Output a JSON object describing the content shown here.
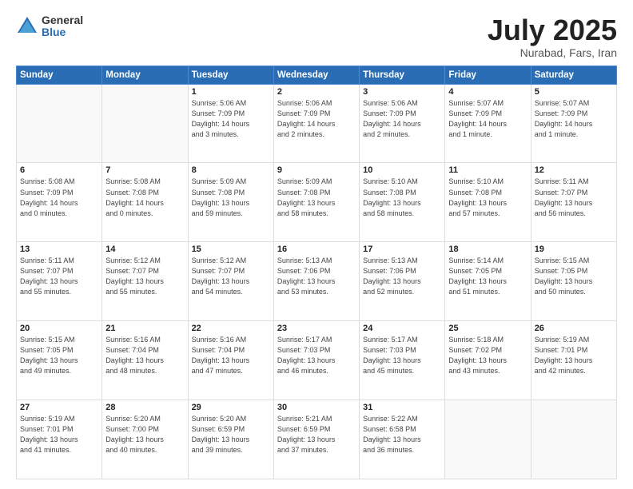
{
  "logo": {
    "general": "General",
    "blue": "Blue"
  },
  "title": "July 2025",
  "location": "Nurabad, Fars, Iran",
  "days_of_week": [
    "Sunday",
    "Monday",
    "Tuesday",
    "Wednesday",
    "Thursday",
    "Friday",
    "Saturday"
  ],
  "weeks": [
    [
      {
        "day": "",
        "detail": ""
      },
      {
        "day": "",
        "detail": ""
      },
      {
        "day": "1",
        "detail": "Sunrise: 5:06 AM\nSunset: 7:09 PM\nDaylight: 14 hours\nand 3 minutes."
      },
      {
        "day": "2",
        "detail": "Sunrise: 5:06 AM\nSunset: 7:09 PM\nDaylight: 14 hours\nand 2 minutes."
      },
      {
        "day": "3",
        "detail": "Sunrise: 5:06 AM\nSunset: 7:09 PM\nDaylight: 14 hours\nand 2 minutes."
      },
      {
        "day": "4",
        "detail": "Sunrise: 5:07 AM\nSunset: 7:09 PM\nDaylight: 14 hours\nand 1 minute."
      },
      {
        "day": "5",
        "detail": "Sunrise: 5:07 AM\nSunset: 7:09 PM\nDaylight: 14 hours\nand 1 minute."
      }
    ],
    [
      {
        "day": "6",
        "detail": "Sunrise: 5:08 AM\nSunset: 7:09 PM\nDaylight: 14 hours\nand 0 minutes."
      },
      {
        "day": "7",
        "detail": "Sunrise: 5:08 AM\nSunset: 7:08 PM\nDaylight: 14 hours\nand 0 minutes."
      },
      {
        "day": "8",
        "detail": "Sunrise: 5:09 AM\nSunset: 7:08 PM\nDaylight: 13 hours\nand 59 minutes."
      },
      {
        "day": "9",
        "detail": "Sunrise: 5:09 AM\nSunset: 7:08 PM\nDaylight: 13 hours\nand 58 minutes."
      },
      {
        "day": "10",
        "detail": "Sunrise: 5:10 AM\nSunset: 7:08 PM\nDaylight: 13 hours\nand 58 minutes."
      },
      {
        "day": "11",
        "detail": "Sunrise: 5:10 AM\nSunset: 7:08 PM\nDaylight: 13 hours\nand 57 minutes."
      },
      {
        "day": "12",
        "detail": "Sunrise: 5:11 AM\nSunset: 7:07 PM\nDaylight: 13 hours\nand 56 minutes."
      }
    ],
    [
      {
        "day": "13",
        "detail": "Sunrise: 5:11 AM\nSunset: 7:07 PM\nDaylight: 13 hours\nand 55 minutes."
      },
      {
        "day": "14",
        "detail": "Sunrise: 5:12 AM\nSunset: 7:07 PM\nDaylight: 13 hours\nand 55 minutes."
      },
      {
        "day": "15",
        "detail": "Sunrise: 5:12 AM\nSunset: 7:07 PM\nDaylight: 13 hours\nand 54 minutes."
      },
      {
        "day": "16",
        "detail": "Sunrise: 5:13 AM\nSunset: 7:06 PM\nDaylight: 13 hours\nand 53 minutes."
      },
      {
        "day": "17",
        "detail": "Sunrise: 5:13 AM\nSunset: 7:06 PM\nDaylight: 13 hours\nand 52 minutes."
      },
      {
        "day": "18",
        "detail": "Sunrise: 5:14 AM\nSunset: 7:05 PM\nDaylight: 13 hours\nand 51 minutes."
      },
      {
        "day": "19",
        "detail": "Sunrise: 5:15 AM\nSunset: 7:05 PM\nDaylight: 13 hours\nand 50 minutes."
      }
    ],
    [
      {
        "day": "20",
        "detail": "Sunrise: 5:15 AM\nSunset: 7:05 PM\nDaylight: 13 hours\nand 49 minutes."
      },
      {
        "day": "21",
        "detail": "Sunrise: 5:16 AM\nSunset: 7:04 PM\nDaylight: 13 hours\nand 48 minutes."
      },
      {
        "day": "22",
        "detail": "Sunrise: 5:16 AM\nSunset: 7:04 PM\nDaylight: 13 hours\nand 47 minutes."
      },
      {
        "day": "23",
        "detail": "Sunrise: 5:17 AM\nSunset: 7:03 PM\nDaylight: 13 hours\nand 46 minutes."
      },
      {
        "day": "24",
        "detail": "Sunrise: 5:17 AM\nSunset: 7:03 PM\nDaylight: 13 hours\nand 45 minutes."
      },
      {
        "day": "25",
        "detail": "Sunrise: 5:18 AM\nSunset: 7:02 PM\nDaylight: 13 hours\nand 43 minutes."
      },
      {
        "day": "26",
        "detail": "Sunrise: 5:19 AM\nSunset: 7:01 PM\nDaylight: 13 hours\nand 42 minutes."
      }
    ],
    [
      {
        "day": "27",
        "detail": "Sunrise: 5:19 AM\nSunset: 7:01 PM\nDaylight: 13 hours\nand 41 minutes."
      },
      {
        "day": "28",
        "detail": "Sunrise: 5:20 AM\nSunset: 7:00 PM\nDaylight: 13 hours\nand 40 minutes."
      },
      {
        "day": "29",
        "detail": "Sunrise: 5:20 AM\nSunset: 6:59 PM\nDaylight: 13 hours\nand 39 minutes."
      },
      {
        "day": "30",
        "detail": "Sunrise: 5:21 AM\nSunset: 6:59 PM\nDaylight: 13 hours\nand 37 minutes."
      },
      {
        "day": "31",
        "detail": "Sunrise: 5:22 AM\nSunset: 6:58 PM\nDaylight: 13 hours\nand 36 minutes."
      },
      {
        "day": "",
        "detail": ""
      },
      {
        "day": "",
        "detail": ""
      }
    ]
  ]
}
